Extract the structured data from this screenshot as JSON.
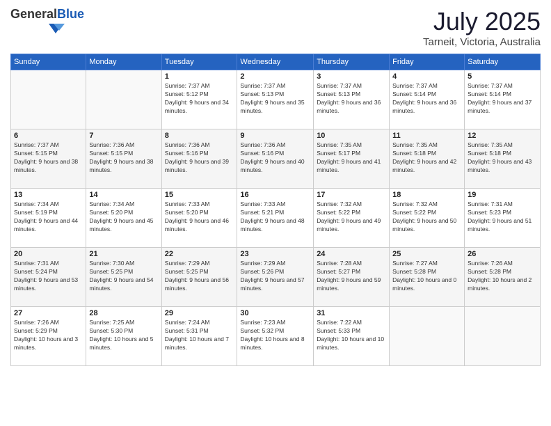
{
  "logo": {
    "general": "General",
    "blue": "Blue"
  },
  "header": {
    "month": "July 2025",
    "location": "Tarneit, Victoria, Australia"
  },
  "weekdays": [
    "Sunday",
    "Monday",
    "Tuesday",
    "Wednesday",
    "Thursday",
    "Friday",
    "Saturday"
  ],
  "weeks": [
    [
      {
        "day": "",
        "sunrise": "",
        "sunset": "",
        "daylight": ""
      },
      {
        "day": "",
        "sunrise": "",
        "sunset": "",
        "daylight": ""
      },
      {
        "day": "1",
        "sunrise": "Sunrise: 7:37 AM",
        "sunset": "Sunset: 5:12 PM",
        "daylight": "Daylight: 9 hours and 34 minutes."
      },
      {
        "day": "2",
        "sunrise": "Sunrise: 7:37 AM",
        "sunset": "Sunset: 5:13 PM",
        "daylight": "Daylight: 9 hours and 35 minutes."
      },
      {
        "day": "3",
        "sunrise": "Sunrise: 7:37 AM",
        "sunset": "Sunset: 5:13 PM",
        "daylight": "Daylight: 9 hours and 36 minutes."
      },
      {
        "day": "4",
        "sunrise": "Sunrise: 7:37 AM",
        "sunset": "Sunset: 5:14 PM",
        "daylight": "Daylight: 9 hours and 36 minutes."
      },
      {
        "day": "5",
        "sunrise": "Sunrise: 7:37 AM",
        "sunset": "Sunset: 5:14 PM",
        "daylight": "Daylight: 9 hours and 37 minutes."
      }
    ],
    [
      {
        "day": "6",
        "sunrise": "Sunrise: 7:37 AM",
        "sunset": "Sunset: 5:15 PM",
        "daylight": "Daylight: 9 hours and 38 minutes."
      },
      {
        "day": "7",
        "sunrise": "Sunrise: 7:36 AM",
        "sunset": "Sunset: 5:15 PM",
        "daylight": "Daylight: 9 hours and 38 minutes."
      },
      {
        "day": "8",
        "sunrise": "Sunrise: 7:36 AM",
        "sunset": "Sunset: 5:16 PM",
        "daylight": "Daylight: 9 hours and 39 minutes."
      },
      {
        "day": "9",
        "sunrise": "Sunrise: 7:36 AM",
        "sunset": "Sunset: 5:16 PM",
        "daylight": "Daylight: 9 hours and 40 minutes."
      },
      {
        "day": "10",
        "sunrise": "Sunrise: 7:35 AM",
        "sunset": "Sunset: 5:17 PM",
        "daylight": "Daylight: 9 hours and 41 minutes."
      },
      {
        "day": "11",
        "sunrise": "Sunrise: 7:35 AM",
        "sunset": "Sunset: 5:18 PM",
        "daylight": "Daylight: 9 hours and 42 minutes."
      },
      {
        "day": "12",
        "sunrise": "Sunrise: 7:35 AM",
        "sunset": "Sunset: 5:18 PM",
        "daylight": "Daylight: 9 hours and 43 minutes."
      }
    ],
    [
      {
        "day": "13",
        "sunrise": "Sunrise: 7:34 AM",
        "sunset": "Sunset: 5:19 PM",
        "daylight": "Daylight: 9 hours and 44 minutes."
      },
      {
        "day": "14",
        "sunrise": "Sunrise: 7:34 AM",
        "sunset": "Sunset: 5:20 PM",
        "daylight": "Daylight: 9 hours and 45 minutes."
      },
      {
        "day": "15",
        "sunrise": "Sunrise: 7:33 AM",
        "sunset": "Sunset: 5:20 PM",
        "daylight": "Daylight: 9 hours and 46 minutes."
      },
      {
        "day": "16",
        "sunrise": "Sunrise: 7:33 AM",
        "sunset": "Sunset: 5:21 PM",
        "daylight": "Daylight: 9 hours and 48 minutes."
      },
      {
        "day": "17",
        "sunrise": "Sunrise: 7:32 AM",
        "sunset": "Sunset: 5:22 PM",
        "daylight": "Daylight: 9 hours and 49 minutes."
      },
      {
        "day": "18",
        "sunrise": "Sunrise: 7:32 AM",
        "sunset": "Sunset: 5:22 PM",
        "daylight": "Daylight: 9 hours and 50 minutes."
      },
      {
        "day": "19",
        "sunrise": "Sunrise: 7:31 AM",
        "sunset": "Sunset: 5:23 PM",
        "daylight": "Daylight: 9 hours and 51 minutes."
      }
    ],
    [
      {
        "day": "20",
        "sunrise": "Sunrise: 7:31 AM",
        "sunset": "Sunset: 5:24 PM",
        "daylight": "Daylight: 9 hours and 53 minutes."
      },
      {
        "day": "21",
        "sunrise": "Sunrise: 7:30 AM",
        "sunset": "Sunset: 5:25 PM",
        "daylight": "Daylight: 9 hours and 54 minutes."
      },
      {
        "day": "22",
        "sunrise": "Sunrise: 7:29 AM",
        "sunset": "Sunset: 5:25 PM",
        "daylight": "Daylight: 9 hours and 56 minutes."
      },
      {
        "day": "23",
        "sunrise": "Sunrise: 7:29 AM",
        "sunset": "Sunset: 5:26 PM",
        "daylight": "Daylight: 9 hours and 57 minutes."
      },
      {
        "day": "24",
        "sunrise": "Sunrise: 7:28 AM",
        "sunset": "Sunset: 5:27 PM",
        "daylight": "Daylight: 9 hours and 59 minutes."
      },
      {
        "day": "25",
        "sunrise": "Sunrise: 7:27 AM",
        "sunset": "Sunset: 5:28 PM",
        "daylight": "Daylight: 10 hours and 0 minutes."
      },
      {
        "day": "26",
        "sunrise": "Sunrise: 7:26 AM",
        "sunset": "Sunset: 5:28 PM",
        "daylight": "Daylight: 10 hours and 2 minutes."
      }
    ],
    [
      {
        "day": "27",
        "sunrise": "Sunrise: 7:26 AM",
        "sunset": "Sunset: 5:29 PM",
        "daylight": "Daylight: 10 hours and 3 minutes."
      },
      {
        "day": "28",
        "sunrise": "Sunrise: 7:25 AM",
        "sunset": "Sunset: 5:30 PM",
        "daylight": "Daylight: 10 hours and 5 minutes."
      },
      {
        "day": "29",
        "sunrise": "Sunrise: 7:24 AM",
        "sunset": "Sunset: 5:31 PM",
        "daylight": "Daylight: 10 hours and 7 minutes."
      },
      {
        "day": "30",
        "sunrise": "Sunrise: 7:23 AM",
        "sunset": "Sunset: 5:32 PM",
        "daylight": "Daylight: 10 hours and 8 minutes."
      },
      {
        "day": "31",
        "sunrise": "Sunrise: 7:22 AM",
        "sunset": "Sunset: 5:33 PM",
        "daylight": "Daylight: 10 hours and 10 minutes."
      },
      {
        "day": "",
        "sunrise": "",
        "sunset": "",
        "daylight": ""
      },
      {
        "day": "",
        "sunrise": "",
        "sunset": "",
        "daylight": ""
      }
    ]
  ]
}
